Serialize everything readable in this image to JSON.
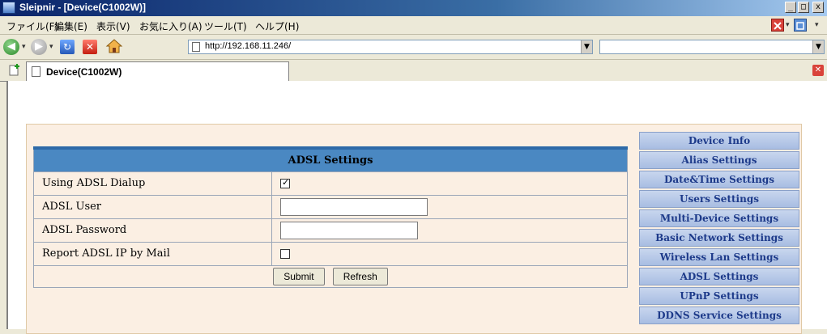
{
  "window": {
    "title": "Sleipnir - [Device(C1002W)]",
    "min_label": "_",
    "max_label": "□",
    "close_label": "x"
  },
  "menubar": {
    "items": [
      "ファイル(F)",
      "編集(E)",
      "表示(V)",
      "お気に入り(A)",
      "ツール(T)",
      "ヘルプ(H)"
    ]
  },
  "toolbar": {
    "address": "http://192.168.11.246/",
    "search_text": ""
  },
  "tabs": [
    {
      "label": "Device(C1002W)",
      "active": true
    }
  ],
  "adsl": {
    "title": "ADSL Settings",
    "rows": [
      {
        "label": "Using ADSL Dialup",
        "type": "checkbox",
        "checked": true
      },
      {
        "label": "ADSL User",
        "type": "text",
        "value": ""
      },
      {
        "label": "ADSL Password",
        "type": "password",
        "value": ""
      },
      {
        "label": "Report ADSL IP by Mail",
        "type": "checkbox",
        "checked": false
      }
    ],
    "submit_label": "Submit",
    "refresh_label": "Refresh",
    "check_mark": "✓"
  },
  "side_menu": [
    "Device Info",
    "Alias Settings",
    "Date&Time Settings",
    "Users Settings",
    "Multi-Device Settings",
    "Basic Network Settings",
    "Wireless Lan Settings",
    "ADSL Settings",
    "UPnP Settings",
    "DDNS Service Settings"
  ],
  "colors": {
    "title_gradient_start": "#0a246a",
    "form_header": "#4a88c2",
    "panel_bg": "#fbefe3",
    "menu_link": "#1d3a8a"
  }
}
